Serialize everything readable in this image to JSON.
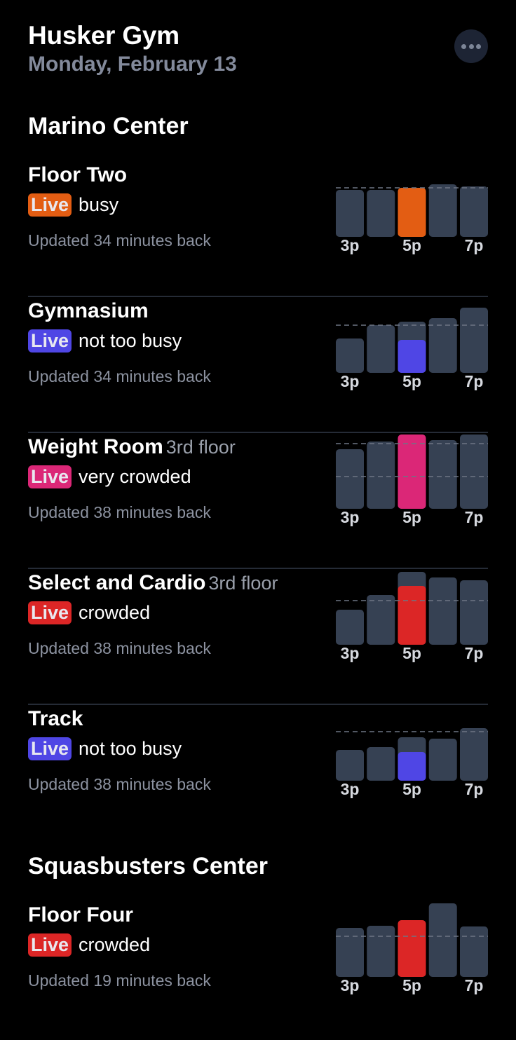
{
  "app": {
    "title": "Husker Gym",
    "date": "Monday, February 13",
    "more_icon": "ellipsis-icon"
  },
  "colors": {
    "busy": "#e35d13",
    "not_too_busy": "#4f46e5",
    "very_crowded": "#db2777",
    "crowded": "#dc2626",
    "bar_gray": "#364153",
    "dash": "#6e7584"
  },
  "sections": [
    {
      "name": "Marino Center",
      "areas": [
        {
          "name": "Floor Two",
          "subtitle": "",
          "badge": "Live",
          "status": "busy",
          "color": "#e35d13",
          "updated": "Updated 34 minutes back",
          "chart_data": {
            "type": "bar",
            "categories": [
              "3p",
              "4p",
              "5p",
              "6p",
              "7p"
            ],
            "tick_labels": [
              "3p",
              "",
              "5p",
              "",
              "7p"
            ],
            "usual": [
              0.67,
              0.67,
              0.7,
              0.75,
              0.72
            ],
            "live": [
              null,
              null,
              0.7,
              null,
              null
            ],
            "reference_lines": [
              0.7
            ],
            "ylim": [
              0,
              1
            ]
          }
        },
        {
          "name": "Gymnasium",
          "subtitle": "",
          "badge": "Live",
          "status": "not too busy",
          "color": "#4f46e5",
          "updated": "Updated 34 minutes back",
          "chart_data": {
            "type": "bar",
            "categories": [
              "3p",
              "4p",
              "5p",
              "6p",
              "7p"
            ],
            "tick_labels": [
              "3p",
              "",
              "5p",
              "",
              "7p"
            ],
            "usual": [
              0.49,
              0.68,
              0.73,
              0.78,
              0.93
            ],
            "live": [
              null,
              null,
              0.47,
              null,
              null
            ],
            "reference_lines": [
              0.68
            ],
            "ylim": [
              0,
              1
            ]
          }
        },
        {
          "name": "Weight Room",
          "subtitle": "3rd floor",
          "badge": "Live",
          "status": "very crowded",
          "color": "#db2777",
          "updated": "Updated 38 minutes back",
          "chart_data": {
            "type": "bar",
            "categories": [
              "3p",
              "4p",
              "5p",
              "6p",
              "7p"
            ],
            "tick_labels": [
              "3p",
              "",
              "5p",
              "",
              "7p"
            ],
            "usual": [
              0.85,
              0.96,
              0.85,
              0.98,
              1.06
            ],
            "live": [
              null,
              null,
              1.06,
              null,
              null
            ],
            "reference_lines": [
              0.93,
              0.46
            ],
            "ylim": [
              0,
              1.1
            ]
          }
        },
        {
          "name": "Select and Cardio",
          "subtitle": "3rd floor",
          "badge": "Live",
          "status": "crowded",
          "color": "#dc2626",
          "updated": "Updated 38 minutes back",
          "chart_data": {
            "type": "bar",
            "categories": [
              "3p",
              "4p",
              "5p",
              "6p",
              "7p"
            ],
            "tick_labels": [
              "3p",
              "",
              "5p",
              "",
              "7p"
            ],
            "usual": [
              0.5,
              0.71,
              1.04,
              0.96,
              0.92
            ],
            "live": [
              null,
              null,
              0.84,
              null,
              null
            ],
            "reference_lines": [
              0.63
            ],
            "ylim": [
              0,
              1.1
            ]
          }
        },
        {
          "name": "Track",
          "subtitle": "",
          "badge": "Live",
          "status": "not too busy",
          "color": "#4f46e5",
          "updated": "Updated 38 minutes back",
          "chart_data": {
            "type": "bar",
            "categories": [
              "3p",
              "4p",
              "5p",
              "6p",
              "7p"
            ],
            "tick_labels": [
              "3p",
              "",
              "5p",
              "",
              "7p"
            ],
            "usual": [
              0.44,
              0.48,
              0.62,
              0.6,
              0.75
            ],
            "live": [
              null,
              null,
              0.41,
              null,
              null
            ],
            "reference_lines": [
              0.7
            ],
            "ylim": [
              0,
              1
            ]
          }
        }
      ]
    },
    {
      "name": "Squasbusters Center",
      "areas": [
        {
          "name": "Floor Four",
          "subtitle": "",
          "badge": "Live",
          "status": "crowded",
          "color": "#dc2626",
          "updated": "Updated 19 minutes back",
          "chart_data": {
            "type": "bar",
            "categories": [
              "3p",
              "4p",
              "5p",
              "6p",
              "7p"
            ],
            "tick_labels": [
              "3p",
              "",
              "5p",
              "",
              "7p"
            ],
            "usual": [
              0.7,
              0.73,
              0.8,
              1.05,
              0.72
            ],
            "live": [
              null,
              null,
              0.81,
              null,
              null
            ],
            "reference_lines": [
              0.58
            ],
            "ylim": [
              0,
              1.1
            ]
          }
        }
      ]
    }
  ]
}
